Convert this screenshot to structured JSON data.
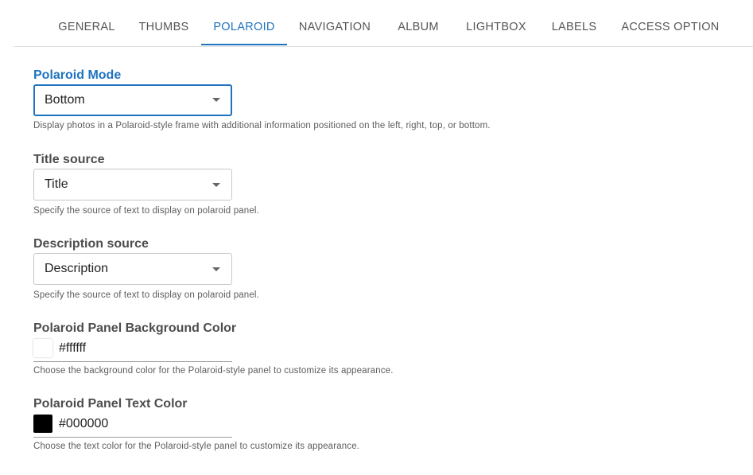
{
  "tabs": [
    {
      "label": "GENERAL"
    },
    {
      "label": "THUMBS"
    },
    {
      "label": "POLAROID"
    },
    {
      "label": "NAVIGATION"
    },
    {
      "label": "ALBUM"
    },
    {
      "label": "LIGHTBOX"
    },
    {
      "label": "LABELS"
    },
    {
      "label": "ACCESS OPTION"
    }
  ],
  "active_tab": "POLAROID",
  "accent_color": "#1e73be",
  "fields": {
    "polaroid_mode": {
      "label": "Polaroid Mode",
      "value": "Bottom",
      "help": "Display photos in a Polaroid-style frame with additional information positioned on the left, right, top, or bottom."
    },
    "title_source": {
      "label": "Title source",
      "value": "Title",
      "help": "Specify the source of text to display on polaroid panel."
    },
    "description_source": {
      "label": "Description source",
      "value": "Description",
      "help": "Specify the source of text to display on polaroid panel."
    },
    "panel_bg_color": {
      "label": "Polaroid Panel Background Color",
      "value": "#ffffff",
      "help": "Choose the background color for the Polaroid-style panel to customize its appearance."
    },
    "panel_text_color": {
      "label": "Polaroid Panel Text Color",
      "value": "#000000",
      "help": "Choose the text color for the Polaroid-style panel to customize its appearance."
    }
  },
  "icons": {
    "dropdown": "caret-down-icon"
  }
}
